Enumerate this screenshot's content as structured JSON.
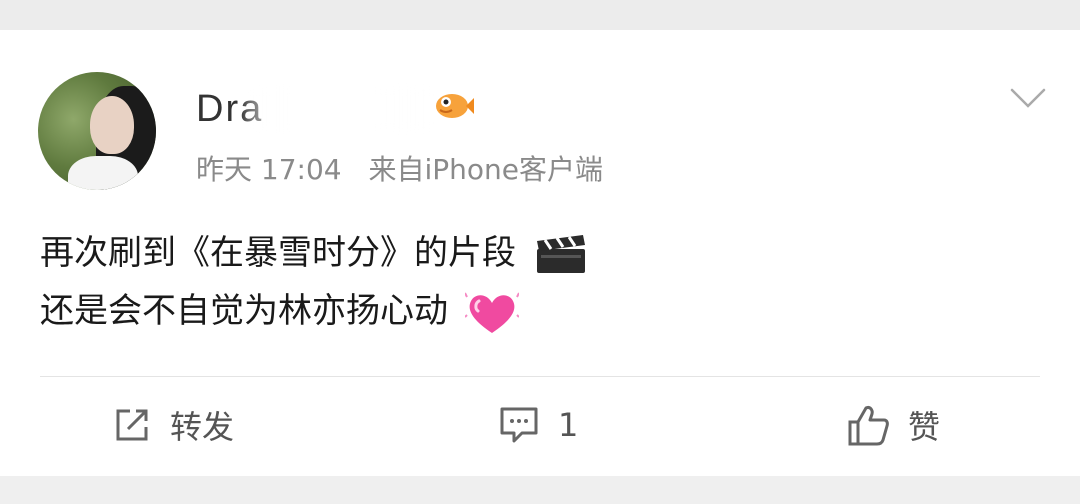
{
  "post": {
    "username": "Dra",
    "timestamp": "昨天 17:04",
    "source": "来自iPhone客户端",
    "content_line1": "再次刷到《在暴雪时分》的片段",
    "content_line2": "还是会不自觉为林亦扬心动",
    "line1_emoji": "clapper-board-icon",
    "line2_emoji": "beating-heart-icon"
  },
  "actions": {
    "repost_label": "转发",
    "comment_count": "1",
    "like_label": "赞"
  },
  "colors": {
    "background": "#f2f2f2",
    "card": "#ffffff",
    "meta_text": "#8a8a8a",
    "heart": "#f04aa0"
  }
}
